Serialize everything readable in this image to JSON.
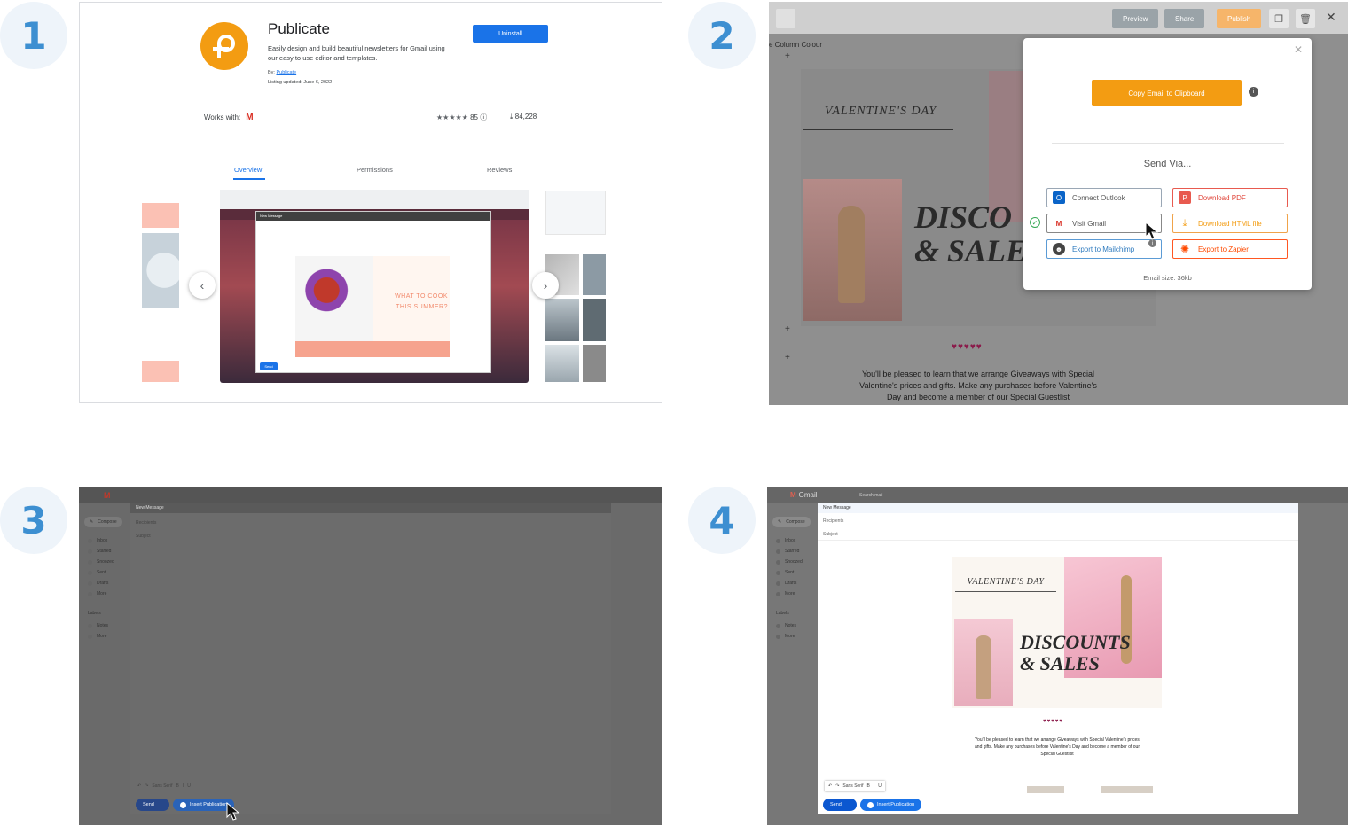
{
  "steps": [
    "1",
    "2",
    "3",
    "4"
  ],
  "panel1": {
    "app_name": "Publicate",
    "description": "Easily design and build beautiful newsletters for Gmail using our easy to use editor and templates.",
    "by_label": "By:",
    "by_link": "Publicate",
    "listing_updated": "Listing updated:  June 6, 2022",
    "uninstall_label": "Uninstall",
    "works_with_label": "Works with:",
    "rating_stars": "★★★★★",
    "rating_count": "85",
    "downloads": "84,228",
    "tabs": [
      "Overview",
      "Permissions",
      "Reviews"
    ],
    "preview_heading": "WHAT TO COOK THIS SUMMER?",
    "preview_compose_title": "New Message",
    "preview_send": "Send",
    "colors": {
      "brand_orange": "#f39c12",
      "google_blue": "#1a73e8"
    }
  },
  "panel2": {
    "column_colour_label": "e Column Colour",
    "preview_label": "Preview",
    "share_label": "Share",
    "publish_label": "Publish",
    "copy_label": "Copy Email to Clipboard",
    "send_via": "Send Via...",
    "options": [
      {
        "label": "Connect Outlook",
        "icon": "outlook-icon"
      },
      {
        "label": "Download PDF",
        "icon": "pdf-icon"
      },
      {
        "label": "Visit Gmail",
        "icon": "gmail-icon"
      },
      {
        "label": "Download HTML file",
        "icon": "download-icon"
      },
      {
        "label": "Export to Mailchimp",
        "icon": "mailchimp-icon"
      },
      {
        "label": "Export to Zapier",
        "icon": "zapier-icon"
      }
    ],
    "email_size": "Email size: 36kb",
    "newsletter_title": "VALENTINE'S DAY",
    "discount_line1": "DISCO",
    "discount_line2": "& SALE",
    "body_text": "You'll be pleased to learn that we arrange Giveaways with Special Valentine's prices and gifts. Make any purchases before Valentine's Day and become a member of our Special Guestlist"
  },
  "panel3": {
    "compose_title": "New Message",
    "recipients": "Recipients",
    "subject": "Subject",
    "font_label": "Sans Serif",
    "send_label": "Send",
    "insert_label": "Insert Publication",
    "sidebar": [
      "Compose",
      "Inbox",
      "Starred",
      "Snoozed",
      "Sent",
      "Drafts",
      "More"
    ],
    "labels_heading": "Labels",
    "labels": [
      "Notes",
      "More"
    ]
  },
  "panel4": {
    "app_label": "Gmail",
    "search_placeholder": "Search mail",
    "compose_title": "New Message",
    "recipients": "Recipients",
    "subject": "Subject",
    "newsletter_title": "VALENTINE'S DAY",
    "discount_line1": "DISCOUNTS",
    "discount_line2": "& SALES",
    "hearts": "♥♥♥♥♥",
    "body_text": "You'll be pleased to learn that we arrange Giveaways with Special Valentine's prices and gifts. Make any purchases before Valentine's Day and become a member of our Special Guestlist",
    "font_label": "Sans Serif",
    "send_label": "Send",
    "insert_label": "Insert Publication",
    "sidebar": [
      "Compose",
      "Inbox",
      "Starred",
      "Snoozed",
      "Sent",
      "Drafts",
      "More"
    ],
    "labels_heading": "Labels",
    "labels": [
      "Notes",
      "More"
    ]
  }
}
